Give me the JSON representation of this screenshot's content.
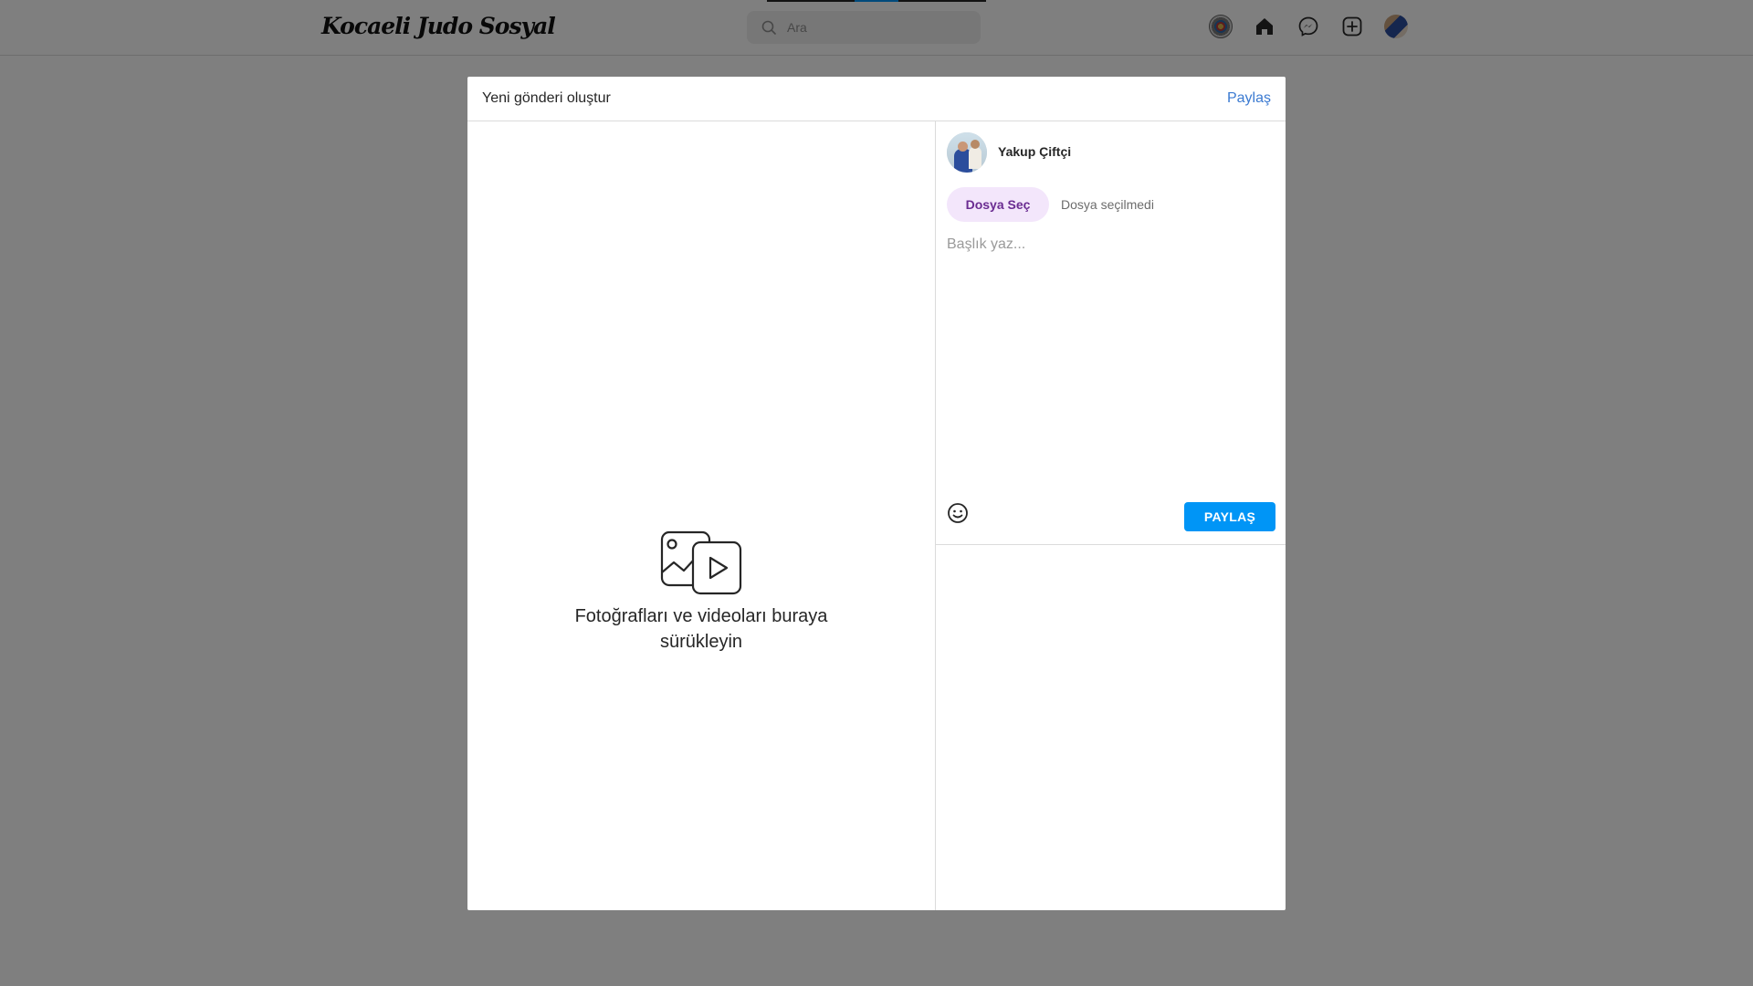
{
  "nav": {
    "logo": "Kocaeli Judo Sosyal",
    "search_placeholder": "Ara",
    "icons": [
      "club-emblem-icon",
      "home-icon",
      "messenger-icon",
      "new-post-icon",
      "profile-avatar"
    ]
  },
  "modal": {
    "title": "Yeni gönderi oluştur",
    "header_share": "Paylaş",
    "drag_text": "Fotoğrafları ve videoları buraya sürükleyin",
    "username": "Yakup Çiftçi",
    "file_button": "Dosya Seç",
    "file_status": "Dosya seçilmedi",
    "caption_placeholder": "Başlık yaz...",
    "share_button": "PAYLAŞ"
  },
  "colors": {
    "accent": "#0095f6",
    "link": "#3b7ad1",
    "file_button_bg": "#f3e6fb",
    "file_button_text": "#6a2c91"
  }
}
